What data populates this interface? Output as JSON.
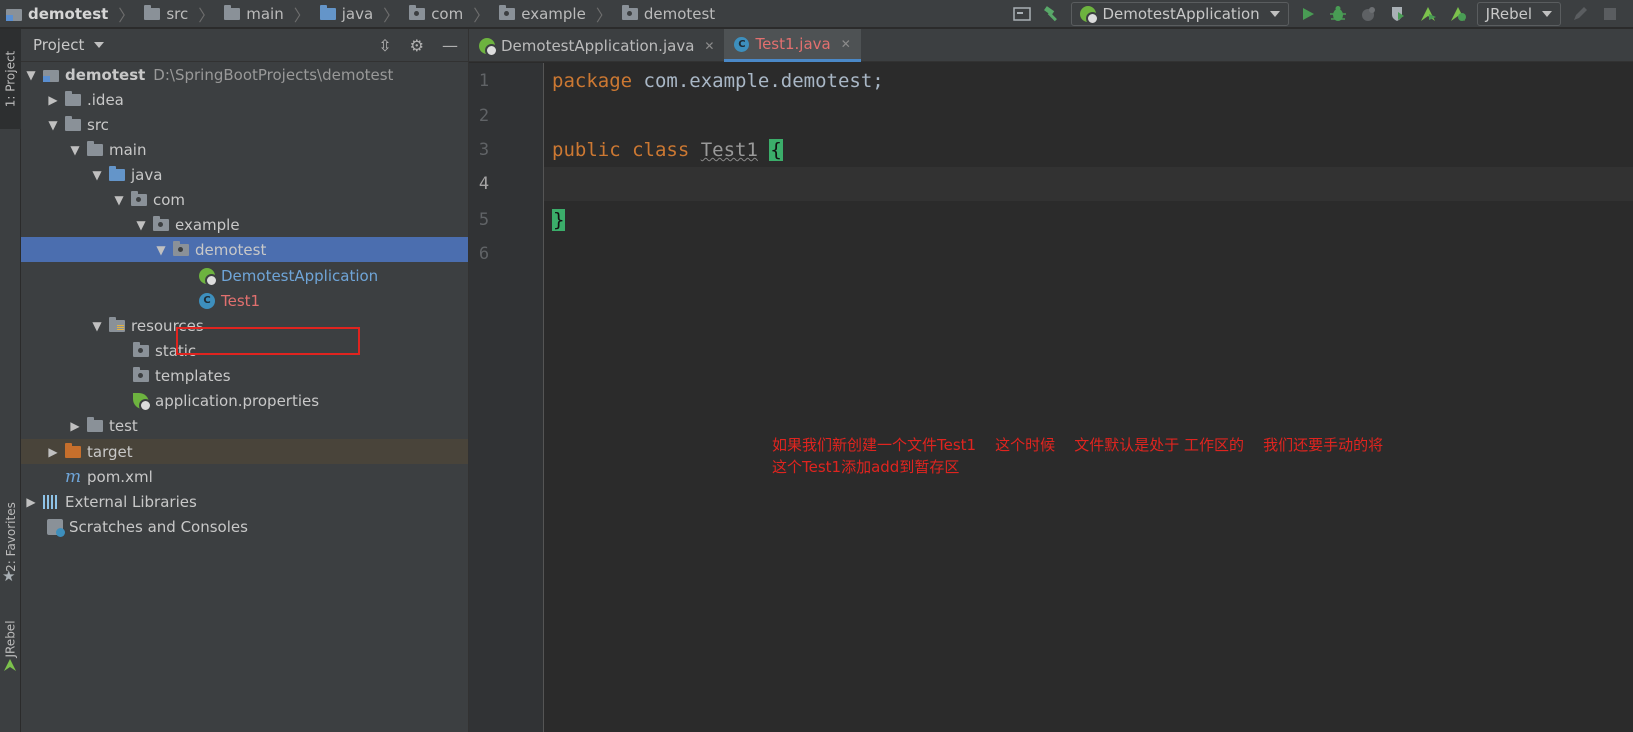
{
  "breadcrumbs": [
    {
      "label": "demotest",
      "icon": "module-folder-icon"
    },
    {
      "label": "src",
      "icon": "folder-icon"
    },
    {
      "label": "main",
      "icon": "folder-icon"
    },
    {
      "label": "java",
      "icon": "source-folder-icon"
    },
    {
      "label": "com",
      "icon": "package-icon"
    },
    {
      "label": "example",
      "icon": "package-icon"
    },
    {
      "label": "demotest",
      "icon": "package-icon"
    }
  ],
  "toolbar": {
    "run_config": "DemotestApplication",
    "jrebel": "JRebel"
  },
  "side_tabs": {
    "project": "1: Project",
    "favorites": "2: Favorites",
    "jrebel": "JRebel"
  },
  "project_panel": {
    "title": "Project",
    "tree": [
      {
        "label": "demotest",
        "path": "D:\\SpringBootProjects\\demotest",
        "bold": true
      },
      {
        "label": ".idea"
      },
      {
        "label": "src"
      },
      {
        "label": "main"
      },
      {
        "label": "java"
      },
      {
        "label": "com"
      },
      {
        "label": "example"
      },
      {
        "label": "demotest"
      },
      {
        "label": "DemotestApplication"
      },
      {
        "label": "Test1"
      },
      {
        "label": "resources"
      },
      {
        "label": "static"
      },
      {
        "label": "templates"
      },
      {
        "label": "application.properties"
      },
      {
        "label": "test"
      },
      {
        "label": "target"
      },
      {
        "label": "pom.xml"
      },
      {
        "label": "External Libraries"
      },
      {
        "label": "Scratches and Consoles"
      }
    ]
  },
  "editor": {
    "tabs": [
      {
        "label": "DemotestApplication.java",
        "active": false
      },
      {
        "label": "Test1.java",
        "active": true
      }
    ],
    "line_numbers": [
      "1",
      "2",
      "3",
      "4",
      "5",
      "6"
    ],
    "lines": {
      "l1_kw": "package",
      "l1_rest": " com.example.demotest;",
      "l3_kw": "public class",
      "l3_name": "Test1",
      "l3_brace": "{",
      "l5_brace": "}"
    }
  },
  "annotation": {
    "line1": "如果我们新创建一个文件Test1    这个时候    文件默认是处于 工作区的    我们还要手动的将",
    "line2": "这个Test1添加add到暂存区"
  },
  "colors": {
    "selection": "#4b6eaf",
    "keyword": "#cc7832",
    "new_file": "#e2706f",
    "annotation": "#e0241f",
    "highlight_brace": "#3bad6a"
  }
}
